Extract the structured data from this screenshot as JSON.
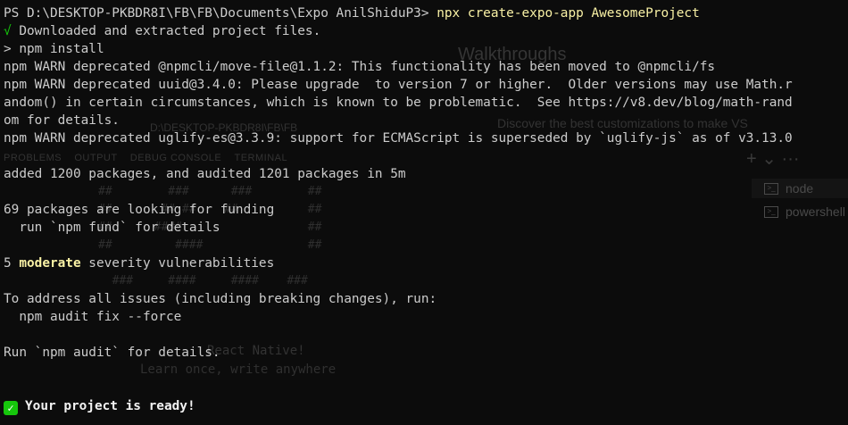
{
  "prompt": {
    "path": "PS D:\\DESKTOP-PKBDR8I\\FB\\FB\\Documents\\Expo AnilShiduP3> ",
    "command": "npx create-expo-app AwesomeProject"
  },
  "lines": {
    "downloaded_mark": "√",
    "downloaded_text": " Downloaded and extracted project files.",
    "npm_install": "> npm install",
    "warn_move_file": "npm WARN deprecated @npmcli/move-file@1.1.2: This functionality has been moved to @npmcli/fs",
    "warn_uuid_1": "npm WARN deprecated uuid@3.4.0: Please upgrade  to version 7 or higher.  Older versions may use Math.r",
    "warn_uuid_2": "andom() in certain circumstances, which is known to be problematic.  See https://v8.dev/blog/math-rand",
    "warn_uuid_3": "om for details.",
    "warn_uglify": "npm WARN deprecated uglify-es@3.3.9: support for ECMAScript is superseded by `uglify-js` as of v3.13.0",
    "added": "added 1200 packages, and audited 1201 packages in 5m",
    "funding_1": "69 packages are looking for funding",
    "funding_2": "  run `npm fund` for details",
    "vuln_count": "5 ",
    "vuln_severity": "moderate",
    "vuln_rest": " severity vulnerabilities",
    "address": "To address all issues (including breaking changes), run:",
    "audit_fix": "  npm audit fix --force",
    "run_audit": "Run `npm audit` for details.",
    "ready_mark": "✓",
    "ready_text": "Your project is ready!"
  },
  "colors": {
    "background": "#0c0c0c",
    "text": "#cccccc",
    "command_yellow": "#f9f1a5",
    "success_green": "#16c60c"
  }
}
